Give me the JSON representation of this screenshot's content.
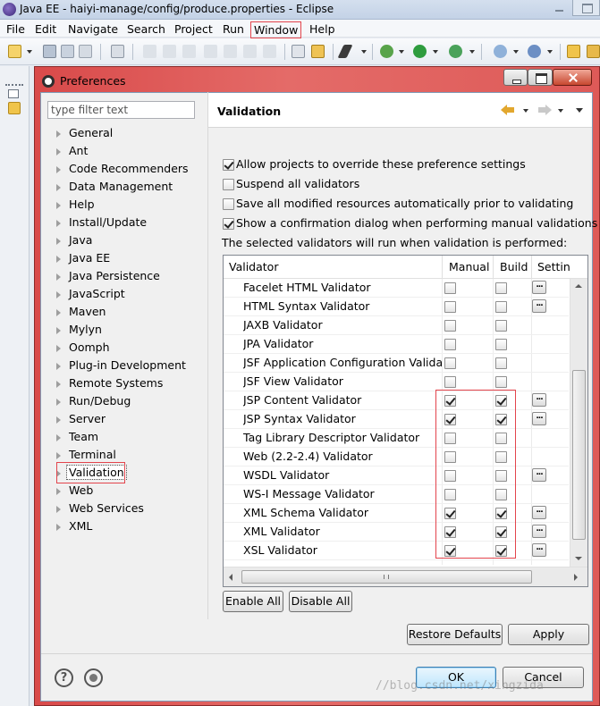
{
  "window": {
    "title": "Java EE - haiyi-manage/config/produce.properties - Eclipse"
  },
  "menubar": {
    "items": [
      "File",
      "Edit",
      "Navigate",
      "Search",
      "Project",
      "Run",
      "Window",
      "Help"
    ]
  },
  "dialog": {
    "title": "Preferences",
    "filter_placeholder": "type filter text",
    "tree": [
      "General",
      "Ant",
      "Code Recommenders",
      "Data Management",
      "Help",
      "Install/Update",
      "Java",
      "Java EE",
      "Java Persistence",
      "JavaScript",
      "Maven",
      "Mylyn",
      "Oomph",
      "Plug-in Development",
      "Remote Systems",
      "Run/Debug",
      "Server",
      "Team",
      "Terminal",
      "Validation",
      "Web",
      "Web Services",
      "XML"
    ],
    "selected_tree_item": "Validation"
  },
  "page": {
    "title": "Validation",
    "options": [
      {
        "label": "Allow projects to override these preference settings",
        "checked": true
      },
      {
        "label": "Suspend all validators",
        "checked": false
      },
      {
        "label": "Save all modified resources automatically prior to validating",
        "checked": false
      },
      {
        "label": "Show a confirmation dialog when performing manual validations",
        "checked": true
      }
    ],
    "info": "The selected validators will run when validation is performed:"
  },
  "table": {
    "headers": {
      "validator": "Validator",
      "manual": "Manual",
      "build": "Build",
      "settings": "Settin"
    },
    "settings_button": "...",
    "rows": [
      {
        "name": "Facelet HTML Validator",
        "manual": false,
        "build": false,
        "settings": true
      },
      {
        "name": "HTML Syntax Validator",
        "manual": false,
        "build": false,
        "settings": true
      },
      {
        "name": "JAXB Validator",
        "manual": false,
        "build": false,
        "settings": false
      },
      {
        "name": "JPA Validator",
        "manual": false,
        "build": false,
        "settings": false
      },
      {
        "name": "JSF Application Configuration Valida...",
        "manual": false,
        "build": false,
        "settings": false
      },
      {
        "name": "JSF View Validator",
        "manual": false,
        "build": false,
        "settings": false
      },
      {
        "name": "JSP Content Validator",
        "manual": true,
        "build": true,
        "settings": true
      },
      {
        "name": "JSP Syntax Validator",
        "manual": true,
        "build": true,
        "settings": true
      },
      {
        "name": "Tag Library Descriptor Validator",
        "manual": false,
        "build": false,
        "settings": false
      },
      {
        "name": "Web (2.2-2.4) Validator",
        "manual": false,
        "build": false,
        "settings": false
      },
      {
        "name": "WSDL Validator",
        "manual": false,
        "build": false,
        "settings": true
      },
      {
        "name": "WS-I Message Validator",
        "manual": false,
        "build": false,
        "settings": false
      },
      {
        "name": "XML Schema Validator",
        "manual": true,
        "build": true,
        "settings": true
      },
      {
        "name": "XML Validator",
        "manual": true,
        "build": true,
        "settings": true
      },
      {
        "name": "XSL Validator",
        "manual": true,
        "build": true,
        "settings": true
      }
    ]
  },
  "buttons": {
    "enable_all": "Enable All",
    "disable_all": "Disable All",
    "restore_defaults": "Restore Defaults",
    "apply": "Apply",
    "ok": "OK",
    "cancel": "Cancel"
  },
  "watermark": "//blog.csdn.net/xingzida"
}
